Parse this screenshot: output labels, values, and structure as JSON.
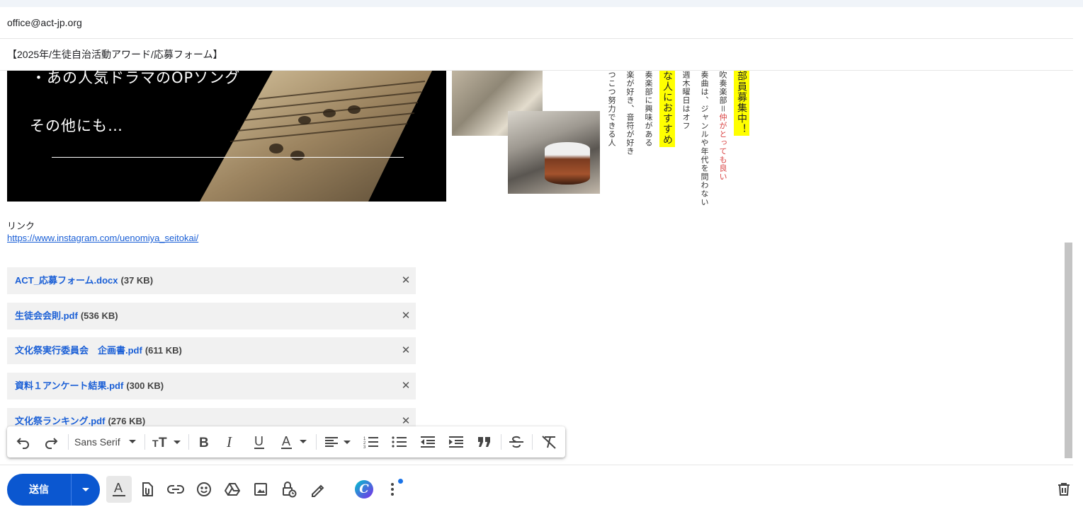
{
  "compose": {
    "to": "office@act-jp.org",
    "subject": "【2025年/生徒自治活動アワード/応募フォーム】"
  },
  "banner": {
    "line1": "・あの人気ドラマのOPソング",
    "line2": "その他にも…"
  },
  "flyer": {
    "col1": "部員募集中！",
    "col2_a": "吹奏楽部＝",
    "col2_b": "仲がとっても良い",
    "col3": "奏曲は、ジャンルや年代を問わない",
    "col4": "週木曜日はオフ",
    "col5": "な人におすすめ",
    "col6": "奏楽部に興味がある",
    "col7": "楽が好き、音符が好き",
    "col8": "つこつ努力できる人"
  },
  "link": {
    "label": "リンク",
    "url": "https://www.instagram.com/uenomiya_seitokai/"
  },
  "attachments": [
    {
      "name": "ACT_応募フォーム.docx",
      "size": "(37 KB)"
    },
    {
      "name": "生徒会会則.pdf",
      "size": "(536 KB)"
    },
    {
      "name": "文化祭実行委員会　企画書.pdf",
      "size": "(611 KB)"
    },
    {
      "name": "資料１アンケート結果.pdf",
      "size": "(300 KB)"
    },
    {
      "name": "文化祭ランキング.pdf",
      "size": "(276 KB)"
    }
  ],
  "formatting_toolbar": {
    "font": "Sans Serif",
    "icons": [
      "undo-icon",
      "redo-icon",
      "font-size-icon",
      "bold-icon",
      "italic-icon",
      "underline-icon",
      "text-color-icon",
      "align-icon",
      "numbered-list-icon",
      "bulleted-list-icon",
      "indent-less-icon",
      "indent-more-icon",
      "quote-icon",
      "strikethrough-icon",
      "remove-formatting-icon"
    ]
  },
  "bottom_bar": {
    "send_label": "送信",
    "icons": [
      "formatting-options-icon",
      "attach-file-icon",
      "insert-link-icon",
      "emoji-icon",
      "google-drive-icon",
      "insert-photo-icon",
      "confidential-mode-icon",
      "signature-icon",
      "canva-icon",
      "more-options-icon",
      "discard-draft-icon"
    ],
    "canva_letter": "C"
  },
  "colors": {
    "accent": "#0b57d0",
    "link": "#1a5fd6",
    "highlight": "#ffff00"
  }
}
